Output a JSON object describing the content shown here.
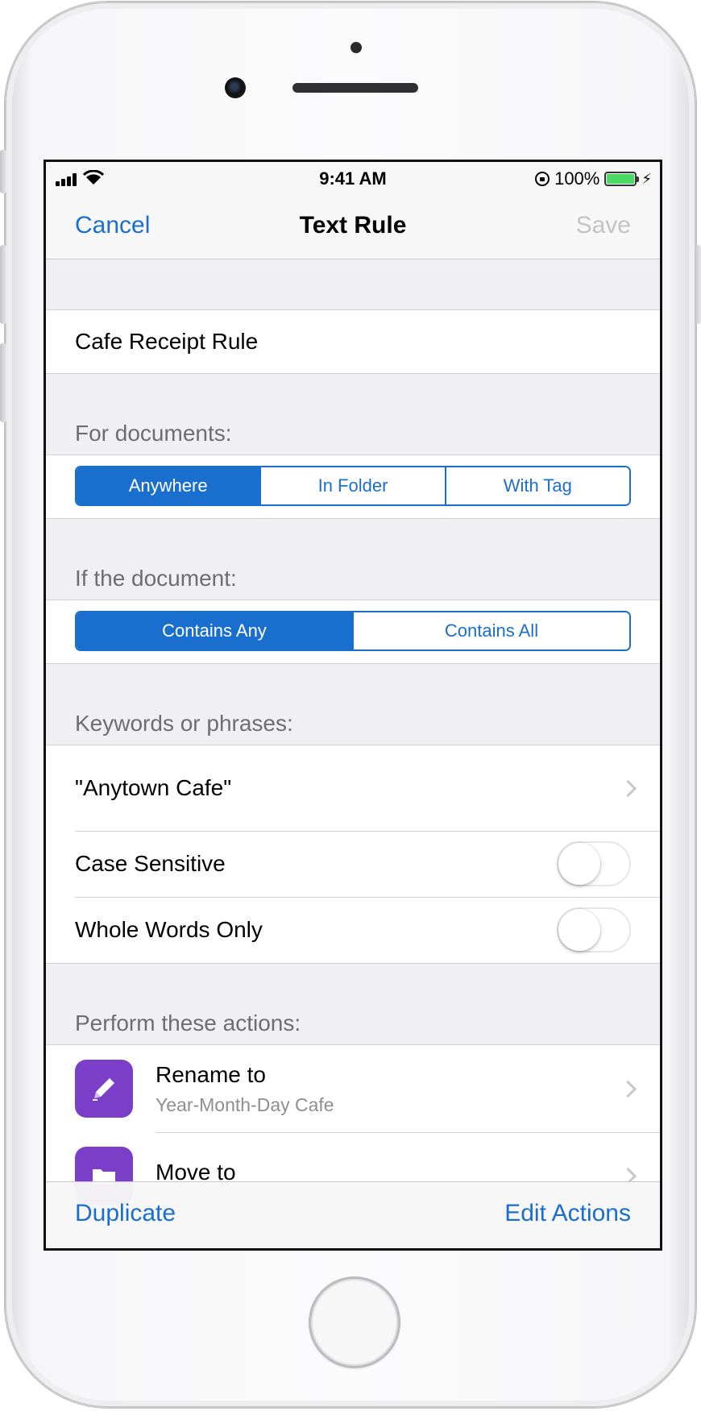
{
  "status_bar": {
    "time": "9:41 AM",
    "battery": "100%"
  },
  "nav": {
    "cancel": "Cancel",
    "title": "Text Rule",
    "save": "Save"
  },
  "rule_name": "Cafe Receipt Rule",
  "documents": {
    "header": "For documents:",
    "options": [
      "Anywhere",
      "In Folder",
      "With Tag"
    ],
    "selected": "Anywhere"
  },
  "match": {
    "header": "If the document:",
    "options": [
      "Contains Any",
      "Contains All"
    ],
    "selected": "Contains Any"
  },
  "keywords": {
    "header": "Keywords or phrases:",
    "value": "\"Anytown Cafe\"",
    "case_sensitive_label": "Case Sensitive",
    "case_sensitive_on": false,
    "whole_words_label": "Whole Words Only",
    "whole_words_on": false
  },
  "actions": {
    "header": "Perform these actions:",
    "items": [
      {
        "title": "Rename to",
        "subtitle": "Year-Month-Day Cafe",
        "icon": "pencil-icon"
      },
      {
        "title": "Move to",
        "subtitle": "",
        "icon": "folder-icon"
      }
    ]
  },
  "toolbar": {
    "duplicate": "Duplicate",
    "edit_actions": "Edit Actions"
  },
  "colors": {
    "tint": "#1a6fce",
    "action_icon": "#7b3ec8",
    "battery": "#4cd964"
  }
}
